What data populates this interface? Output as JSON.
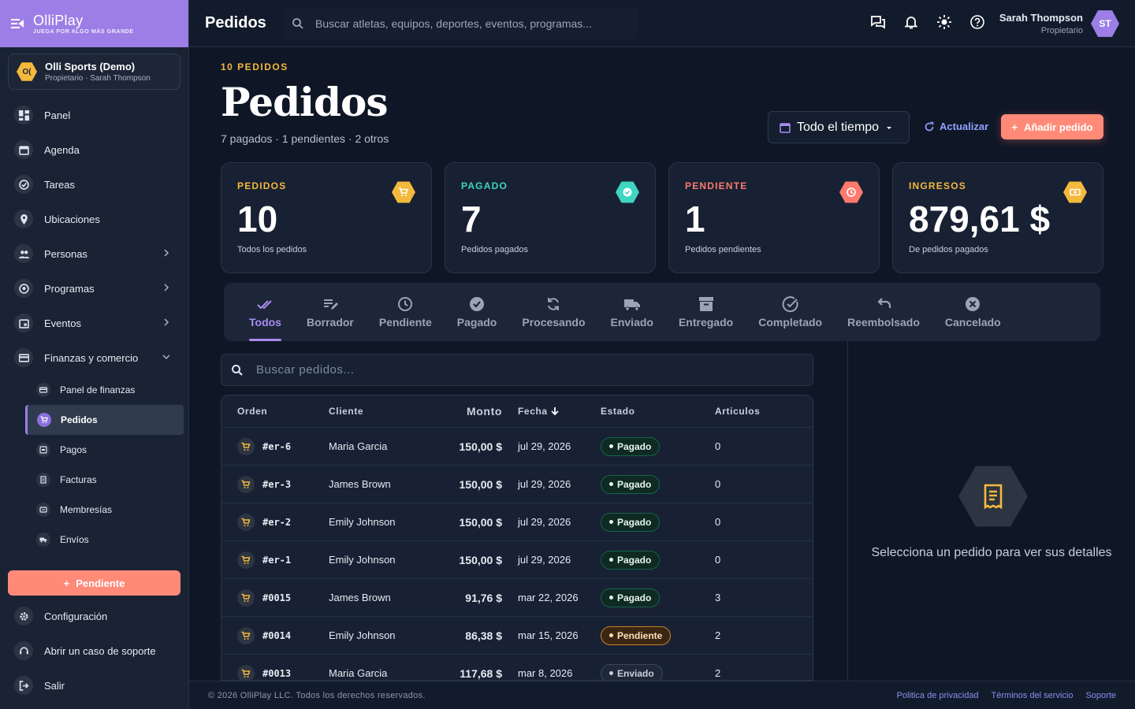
{
  "brand": {
    "name": "OlliPlay",
    "tagline": "JUEGA POR ALGO MÁS GRANDE"
  },
  "org": {
    "badge": "O(",
    "name": "Olli Sports (Demo)",
    "sub": "Propietario · Sarah Thompson"
  },
  "sidebar": {
    "items": [
      {
        "label": "Panel"
      },
      {
        "label": "Agenda"
      },
      {
        "label": "Tareas"
      },
      {
        "label": "Ubicaciones"
      },
      {
        "label": "Personas"
      },
      {
        "label": "Programas"
      },
      {
        "label": "Eventos"
      },
      {
        "label": "Finanzas y comercio"
      }
    ],
    "finance_sub": [
      {
        "label": "Panel de finanzas"
      },
      {
        "label": "Pedidos"
      },
      {
        "label": "Pagos"
      },
      {
        "label": "Facturas"
      },
      {
        "label": "Membresías"
      },
      {
        "label": "Envíos"
      }
    ],
    "pending_button": "Pendiente",
    "bottom": [
      {
        "label": "Configuración"
      },
      {
        "label": "Abrir un caso de soporte"
      },
      {
        "label": "Salir"
      }
    ]
  },
  "topbar": {
    "title": "Pedidos",
    "search_placeholder": "Buscar atletas, equipos, deportes, eventos, programas...",
    "user_name": "Sarah Thompson",
    "user_role": "Propietario",
    "avatar": "ST"
  },
  "header": {
    "eyebrow": "10 PEDIDOS",
    "title": "Pedidos",
    "subtitle": "7 pagados · 1 pendientes · 2 otros",
    "range": "Todo el tiempo",
    "refresh": "Actualizar",
    "add": "Añadir pedido"
  },
  "stats": [
    {
      "label": "PEDIDOS",
      "value": "10",
      "desc": "Todos los pedidos",
      "color": "#f4b93c"
    },
    {
      "label": "PAGADO",
      "value": "7",
      "desc": "Pedidos pagados",
      "color": "#3fd5c0"
    },
    {
      "label": "PENDIENTE",
      "value": "1",
      "desc": "Pedidos pendientes",
      "color": "#ff7a6e"
    },
    {
      "label": "INGRESOS",
      "value": "879,61 $",
      "desc": "De pedidos pagados",
      "color": "#f4b93c"
    }
  ],
  "tabs": [
    {
      "label": "Todos"
    },
    {
      "label": "Borrador"
    },
    {
      "label": "Pendiente"
    },
    {
      "label": "Pagado"
    },
    {
      "label": "Procesando"
    },
    {
      "label": "Enviado"
    },
    {
      "label": "Entregado"
    },
    {
      "label": "Completado"
    },
    {
      "label": "Reembolsado"
    },
    {
      "label": "Cancelado"
    }
  ],
  "orders": {
    "search_placeholder": "Buscar pedidos...",
    "columns": {
      "order": "Orden",
      "client": "Cliente",
      "amount": "Monto",
      "date": "Fecha",
      "status": "Estado",
      "items": "Articulos"
    },
    "rows": [
      {
        "order": "#er-6",
        "client": "Maria Garcia",
        "amount": "150,00 $",
        "date": "jul 29, 2026",
        "status": "Pagado",
        "items": "0"
      },
      {
        "order": "#er-3",
        "client": "James Brown",
        "amount": "150,00 $",
        "date": "jul 29, 2026",
        "status": "Pagado",
        "items": "0"
      },
      {
        "order": "#er-2",
        "client": "Emily Johnson",
        "amount": "150,00 $",
        "date": "jul 29, 2026",
        "status": "Pagado",
        "items": "0"
      },
      {
        "order": "#er-1",
        "client": "Emily Johnson",
        "amount": "150,00 $",
        "date": "jul 29, 2026",
        "status": "Pagado",
        "items": "0"
      },
      {
        "order": "#0015",
        "client": "James Brown",
        "amount": "91,76 $",
        "date": "mar 22, 2026",
        "status": "Pagado",
        "items": "3"
      },
      {
        "order": "#0014",
        "client": "Emily Johnson",
        "amount": "86,38 $",
        "date": "mar 15, 2026",
        "status": "Pendiente",
        "items": "2"
      },
      {
        "order": "#0013",
        "client": "Maria Garcia",
        "amount": "117,68 $",
        "date": "mar 8, 2026",
        "status": "Enviado",
        "items": "2"
      }
    ]
  },
  "detail": {
    "empty": "Selecciona un pedido para ver sus detalles"
  },
  "footer": {
    "copy": "© 2026 OlliPlay LLC. Todos los derechos reservados.",
    "links": [
      "Politica de privacidad",
      "Términos del servicio",
      "Soporte"
    ]
  },
  "colors": {
    "accent": "#9d7ee6",
    "cta": "#ff8a78",
    "gold": "#f4b93c"
  }
}
